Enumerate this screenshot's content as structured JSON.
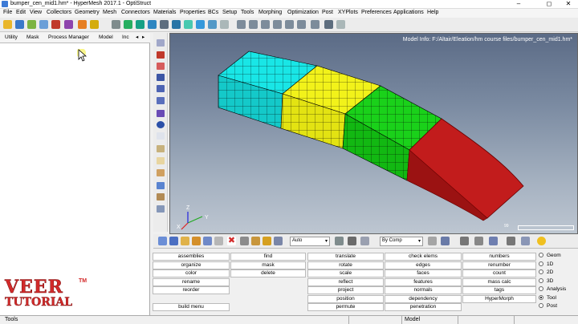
{
  "window": {
    "title": "bumper_cen_mid1.hm* - HyperMesh 2017.1 - OptiStruct",
    "controls": [
      "–",
      "◻",
      "✕"
    ]
  },
  "menubar": [
    "File",
    "Edit",
    "View",
    "Collectors",
    "Geometry",
    "Mesh",
    "Connectors",
    "Materials",
    "Properties",
    "BCs",
    "Setup",
    "Tools",
    "Morphing",
    "Optimization",
    "Post",
    "XYPlots",
    "Preferences",
    "Applications",
    "Help"
  ],
  "left_tabs": [
    "Utility",
    "Mask",
    "Process Manager",
    "Model",
    "Inc"
  ],
  "viewport": {
    "model_info": "Model Info: F:/Altair/Eleation/hm course files/bumper_cen_mid1.hm*",
    "axis_labels": {
      "x": "X",
      "y": "Y",
      "z": "Z"
    },
    "scale_label": "99"
  },
  "bottom_toolbar": {
    "auto_combo": "Auto",
    "bycomp_combo": "By Comp"
  },
  "panel": {
    "col1": [
      "assemblies",
      "organize",
      "color",
      "rename",
      "reorder",
      "",
      "build menu"
    ],
    "col2": [
      "find",
      "mask",
      "delete"
    ],
    "col3": [
      "translate",
      "rotate",
      "scale",
      "reflect",
      "project",
      "position",
      "permute"
    ],
    "col4": [
      "check elems",
      "edges",
      "faces",
      "features",
      "normals",
      "dependency",
      "penetration"
    ],
    "col5": [
      "numbers",
      "renumber",
      "count",
      "mass calc",
      "tags",
      "HyperMorph"
    ],
    "radios": [
      {
        "label": "Geom",
        "on": false
      },
      {
        "label": "1D",
        "on": false
      },
      {
        "label": "2D",
        "on": false
      },
      {
        "label": "3D",
        "on": false
      },
      {
        "label": "Analysis",
        "on": false
      },
      {
        "label": "Tool",
        "on": true
      },
      {
        "label": "Post",
        "on": false
      }
    ]
  },
  "statusbar": {
    "left": "Tools",
    "model": "Model"
  },
  "watermark": {
    "line1": "VEER",
    "line2": "TUTORIAL",
    "tm": "TM"
  },
  "colors": {
    "cyan": "#19e6e6",
    "yellow": "#f2f21a",
    "green": "#1ad11a",
    "red": "#c21c1c",
    "accent": "#d32a2a"
  }
}
